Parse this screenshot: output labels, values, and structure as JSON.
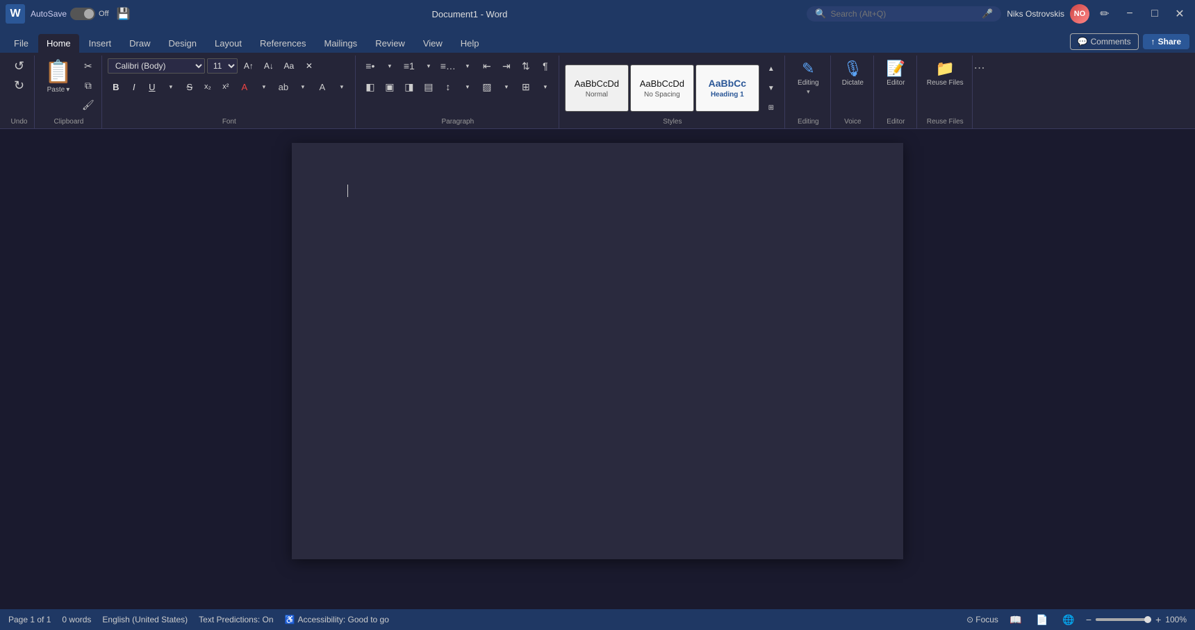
{
  "titlebar": {
    "logo": "W",
    "autosave_label": "AutoSave",
    "toggle_state": "Off",
    "save_icon": "💾",
    "document_title": "Document1  -  Word",
    "search_placeholder": "Search (Alt+Q)",
    "mic_icon": "🎤",
    "user_name": "Niks  Ostrovskis",
    "edit_icon": "✏",
    "minimize_label": "−",
    "restore_label": "□",
    "close_label": "✕"
  },
  "ribbon_tabs": {
    "tabs": [
      "File",
      "Home",
      "Insert",
      "Draw",
      "Design",
      "Layout",
      "References",
      "Mailings",
      "Review",
      "View",
      "Help"
    ],
    "active": "Home",
    "comments_label": "Comments",
    "share_label": "Share"
  },
  "ribbon": {
    "undo_label": "Undo",
    "clipboard": {
      "paste_label": "Paste",
      "cut_icon": "✂",
      "copy_icon": "⧉",
      "format_icon": "🖌",
      "group_label": "Clipboard"
    },
    "font": {
      "face": "Calibri (Body)",
      "size": "11",
      "grow_icon": "A↑",
      "shrink_icon": "A↓",
      "case_icon": "Aa",
      "clear_icon": "✕",
      "bold": "B",
      "italic": "I",
      "underline": "U",
      "strikethrough": "S",
      "subscript": "x₂",
      "superscript": "x²",
      "color_label": "A",
      "highlight_label": "⬜",
      "group_label": "Font"
    },
    "paragraph": {
      "bullets_icon": "≡",
      "numbering_icon": "≡#",
      "multilevel_icon": "≡…",
      "decrease_indent": "⇤",
      "increase_indent": "⇥",
      "sort_icon": "⇅",
      "show_marks": "¶",
      "align_left": "≡",
      "align_center": "≡",
      "align_right": "≡",
      "justify": "≡",
      "line_spacing": "↕",
      "shading": "▨",
      "borders": "⊞",
      "group_label": "Paragraph"
    },
    "styles": {
      "normal_label": "Normal",
      "normal_preview": "AaBbCcDd",
      "no_spacing_label": "No Spacing",
      "no_spacing_preview": "AaBbCcDd",
      "heading_label": "Heading 1",
      "heading_preview": "AaBbCc",
      "group_label": "Styles"
    },
    "voice": {
      "dictate_label": "Dictate",
      "group_label": "Voice"
    },
    "editor": {
      "label": "Editor",
      "group_label": "Editor"
    },
    "editing": {
      "label": "Editing",
      "group_label": "Editing"
    },
    "reuse_files": {
      "label": "Reuse Files",
      "group_label": "Reuse Files"
    }
  },
  "document": {
    "content": ""
  },
  "statusbar": {
    "page_info": "Page 1 of 1",
    "word_count": "0 words",
    "language": "English (United States)",
    "text_predictions": "Text Predictions: On",
    "accessibility": "Accessibility: Good to go",
    "focus_label": "Focus",
    "read_mode_icon": "📖",
    "print_layout_icon": "📄",
    "web_layout_icon": "🌐",
    "zoom_out": "−",
    "zoom_in": "+",
    "zoom_level": "100%"
  }
}
